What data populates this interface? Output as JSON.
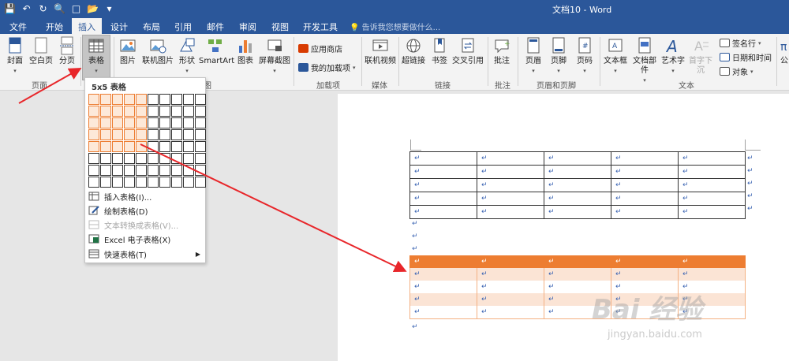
{
  "title_bar": {
    "doc_title": "文档10 - Word"
  },
  "tabs": [
    "文件",
    "开始",
    "插入",
    "设计",
    "布局",
    "引用",
    "邮件",
    "审阅",
    "视图",
    "开发工具"
  ],
  "tell_me": "告诉我您想要做什么...",
  "ribbon": {
    "buttons": [
      "封面",
      "空白页",
      "分页",
      "表格",
      "图片",
      "联机图片",
      "形状",
      "SmartArt",
      "图表",
      "屏幕截图",
      "联机视频",
      "超链接",
      "书签",
      "交叉引用",
      "批注",
      "页眉",
      "页脚",
      "页码",
      "文本框",
      "文档部件",
      "艺术字",
      "首字下沉",
      "公"
    ],
    "small_buttons": [
      "应用商店",
      "我的加载项",
      "签名行",
      "日期和时间",
      "对象"
    ],
    "groups": [
      "页面",
      "图",
      "加载项",
      "媒体",
      "链接",
      "批注",
      "页眉和页脚",
      "文本"
    ]
  },
  "dropdown": {
    "header": "5x5 表格",
    "items": [
      "插入表格(I)...",
      "绘制表格(D)",
      "文本转换成表格(V)...",
      "Excel 电子表格(X)",
      "快速表格(T)"
    ]
  },
  "document": {
    "cell_mark": "↵"
  },
  "watermark": {
    "brand": "Bai 经验",
    "url": "jingyan.baidu.com"
  }
}
